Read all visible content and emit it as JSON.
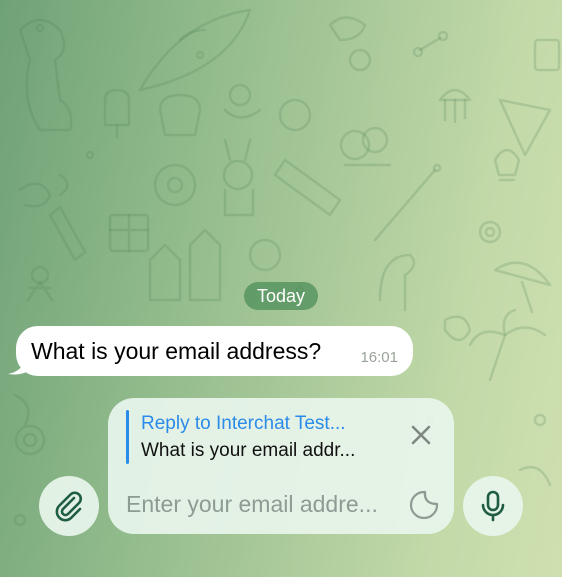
{
  "chat": {
    "date_label": "Today",
    "messages": [
      {
        "text": "What is your email address?",
        "time": "16:01"
      }
    ]
  },
  "composer": {
    "reply": {
      "title": "Reply to Interchat Test...",
      "preview": "What is your email addr..."
    },
    "input_placeholder": "Enter your email addre..."
  },
  "icons": {
    "attach": "paperclip-icon",
    "close": "close-icon",
    "sticker": "sticker-icon",
    "mic": "microphone-icon"
  },
  "colors": {
    "accent": "#2b8be8",
    "date_pill": "#4a8c58",
    "bubble": "#ffffff",
    "composer_bg": "#e8f5ec"
  }
}
